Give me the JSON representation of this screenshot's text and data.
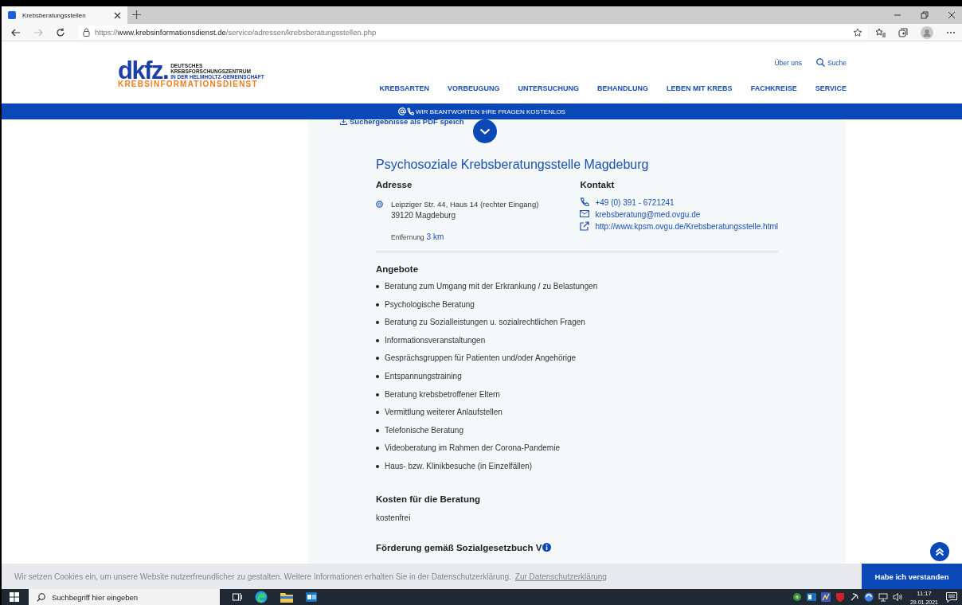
{
  "browser": {
    "tabs": [
      {
        "title": "Krebsberatungsstellen",
        "selected": true
      }
    ],
    "url": {
      "scheme": "https://",
      "host": "www.krebsinformationsdienst.de",
      "path": "/service/adressen/krebsberatungsstellen.php"
    }
  },
  "header": {
    "logo": {
      "wordmark": "dkfz.",
      "lines": [
        "DEUTSCHES",
        "KREBSFORSCHUNGSZENTRUM",
        "IN DER HELMHOLTZ-GEMEINSCHAFT"
      ],
      "subtitle": "KREBSINFORMATIONSDIENST"
    },
    "top_links": [
      {
        "kind": "text",
        "label": "Über uns"
      },
      {
        "kind": "search",
        "label": "Suche"
      }
    ],
    "nav": [
      "KREBSARTEN",
      "VORBEUGUNG",
      "UNTERSUCHUNG",
      "BEHANDLUNG",
      "LEBEN MIT KREBS",
      "FACHKREISE",
      "SERVICE"
    ],
    "banner": "WIR BEANTWORTEN IHRE FRAGEN KOSTENLOS"
  },
  "result": {
    "pdf_link": "Suchergebnisse als PDF speich",
    "title": "Psychosoziale Krebsberatungsstelle Magdeburg",
    "address": {
      "heading": "Adresse",
      "street": "Leipziger Str. 44, Haus 14 (rechter Eingang)",
      "city": "39120 Magdeburg",
      "distance_label": "Entfernung",
      "distance": "3 km"
    },
    "contact": {
      "heading": "Kontakt",
      "items": [
        {
          "kind": "phone",
          "text": "+49 (0) 391 - 6721241"
        },
        {
          "kind": "email",
          "text": "krebsberatung@med.ovgu.de"
        },
        {
          "kind": "web",
          "text": "http://www.kpsm.ovgu.de/Krebsberatungsstelle.html"
        }
      ]
    },
    "offers": {
      "heading": "Angebote",
      "items": [
        "Beratung zum Umgang mit der Erkrankung / zu Belastungen",
        "Psychologische Beratung",
        "Beratung zu Sozialleistungen u. sozialrechtlichen Fragen",
        "Informationsveranstaltungen",
        "Gesprächsgruppen für Patienten und/oder Angehörige",
        "Entspannungstraining",
        "Beratung krebsbetroffener Eltern",
        "Vermittlung weiterer Anlaufstellen",
        "Telefonische Beratung",
        "Videoberatung im Rahmen der Corona-Pandemie",
        "Haus- bzw. Klinikbesuche (in Einzelfällen)"
      ]
    },
    "costs": {
      "heading": "Kosten für die Beratung",
      "text": "kostenfrei"
    },
    "funding": {
      "heading": "Förderung gemäß Sozialgesetzbuch V"
    }
  },
  "cookie": {
    "text": "Wir setzen Cookies ein, um unsere Website nutzerfreundlicher zu gestalten. Weitere Informationen erhalten Sie in der Datenschutzerklärung.",
    "link": "Zur Datenschutzerklärung",
    "button": "Habe ich verstanden"
  },
  "taskbar": {
    "search_placeholder": "Suchbegriff hier eingeben",
    "time": "11:17",
    "date": "29.01.2021"
  }
}
